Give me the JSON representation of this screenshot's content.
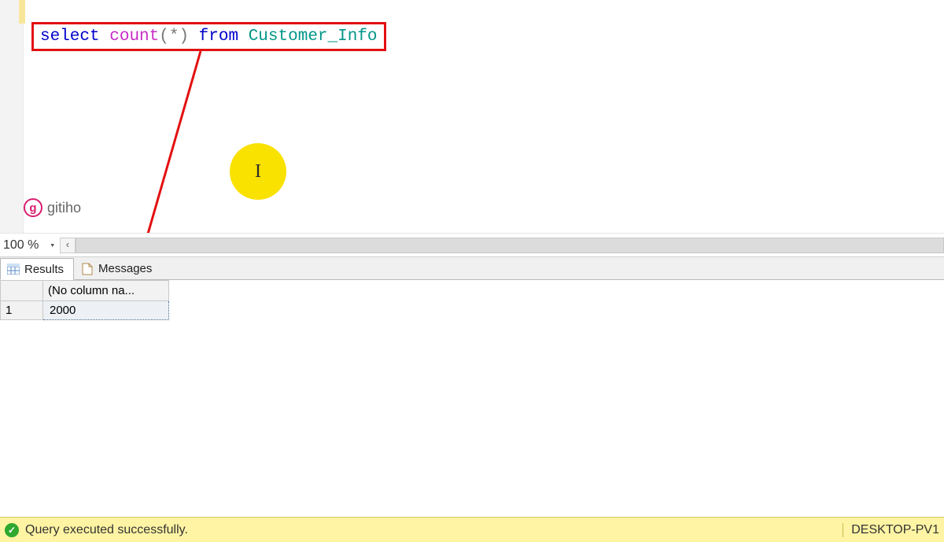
{
  "editor": {
    "sql": {
      "kw_select": "select",
      "fn_count": "count",
      "star_arg": "(*)",
      "kw_from": "from",
      "table": "Customer_Info"
    },
    "cursor_glyph": "I",
    "watermark": "gitiho"
  },
  "zoom": {
    "level": "100 %"
  },
  "tabs": {
    "results": "Results",
    "messages": "Messages"
  },
  "grid": {
    "col_header": "(No column na...",
    "row_num": "1",
    "cell_value": "2000"
  },
  "status": {
    "message": "Query executed successfully.",
    "server": "DESKTOP-PV1"
  }
}
